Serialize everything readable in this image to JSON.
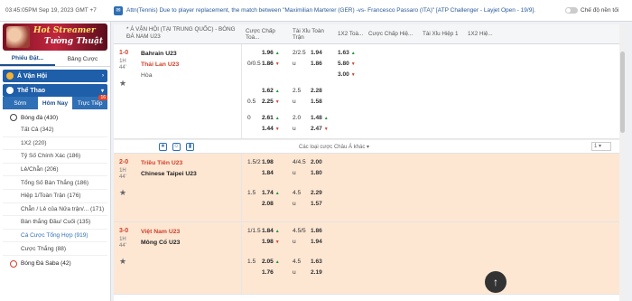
{
  "topbar": {
    "time": "03:45:05PM Sep 19, 2023 GMT +7",
    "marquee": "Attn(Tennis) Due to player replacement, the match between \"Maximilian Marterer (GER) -vs- Francesco Passaro (ITA)\" [ATP Challenger - Layjet Open - 19/9].",
    "toggle_label": "Chế độ nền tối"
  },
  "sidebar": {
    "banner": {
      "line1": "Hot Streamer",
      "line2": "Tường Thuật"
    },
    "tabs": [
      "Phiếu Đặt...",
      "Bảng Cược"
    ],
    "section1": "Á Vận Hội",
    "section2": "Thể Thao",
    "subtabs": [
      "Sớm",
      "Hôm Nay",
      "Trực Tiếp"
    ],
    "live_badge": "16",
    "sport_main": "Bóng đá (430)",
    "items": [
      "Tất Cả (342)",
      "1X2 (220)",
      "Tỷ Số Chính Xác (186)",
      "Lẻ/Chẵn (206)",
      "Tổng Số Bàn Thắng (186)",
      "Hiệp 1/Toàn Trận (176)",
      "Chẵn / Lẻ của Nửa trận/... (171)",
      "Bàn thắng Đầu/ Cuối (135)",
      "Cá Cược Tổng Hợp (919)",
      "Cược Thắng (88)"
    ],
    "sport_bottom": "Bóng Đá Saba (42)"
  },
  "main": {
    "header": {
      "league": "* Á VẬN HỘI (TẠI TRUNG QUỐC) - BÓNG ĐÁ NAM U23",
      "cols": [
        "Cược Chấp Toà...",
        "Tài Xỉu Toàn Trận",
        "1X2 Toà...",
        "Cược Chấp Hiệ...",
        "Tài Xỉu Hiệp 1",
        "1X2 Hiệ..."
      ]
    },
    "matches": [
      {
        "score": "1-0",
        "half": "1H",
        "min": "44'",
        "home": "Bahrain U23",
        "away": "Thái Lan U23",
        "draw": "Hòa",
        "rows": [
          {
            "h": "",
            "a": "1.96",
            "t": "2/2.5",
            "b": "1.94",
            "x": "1.63"
          },
          {
            "h": "0/0.5",
            "a": "1.86",
            "t": "u",
            "b": "1.86",
            "x": "5.80"
          },
          {
            "h": "",
            "a": "",
            "t": "",
            "b": "",
            "x": "3.00"
          },
          {
            "h": "",
            "a": "1.62",
            "t": "2.5",
            "b": "2.28",
            "x": ""
          },
          {
            "h": "0.5",
            "a": "2.25",
            "t": "u",
            "b": "1.58",
            "x": ""
          },
          {
            "h": "0",
            "a": "2.61",
            "t": "2.0",
            "b": "1.48",
            "x": ""
          },
          {
            "h": "",
            "a": "1.44",
            "t": "u",
            "b": "2.47",
            "x": ""
          }
        ],
        "more": "Các loại cược Châu Á khác",
        "select": "1"
      },
      {
        "score": "2-0",
        "half": "1H",
        "min": "44'",
        "home": "Triều Tiên U23",
        "away": "Chinese Taipei U23",
        "rows": [
          {
            "h": "1.5/2",
            "a": "1.98",
            "t": "4/4.5",
            "b": "2.00"
          },
          {
            "h": "",
            "a": "1.84",
            "t": "u",
            "b": "1.80"
          },
          {
            "h": "1.5",
            "a": "1.74",
            "t": "4.5",
            "b": "2.29"
          },
          {
            "h": "",
            "a": "2.08",
            "t": "u",
            "b": "1.57"
          }
        ]
      },
      {
        "score": "3-0",
        "half": "1H",
        "min": "44'",
        "home": "Việt Nam U23",
        "away": "Mông Cổ U23",
        "rows": [
          {
            "h": "1/1.5",
            "a": "1.84",
            "t": "4.5/5",
            "b": "1.86"
          },
          {
            "h": "",
            "a": "1.98",
            "t": "u",
            "b": "1.94"
          },
          {
            "h": "1.5",
            "a": "2.05",
            "t": "4.5",
            "b": "1.63"
          },
          {
            "h": "",
            "a": "1.76",
            "t": "u",
            "b": "2.19"
          }
        ]
      }
    ]
  },
  "icons": {
    "fab": "scroll-top-icon",
    "star": "star-icon"
  }
}
